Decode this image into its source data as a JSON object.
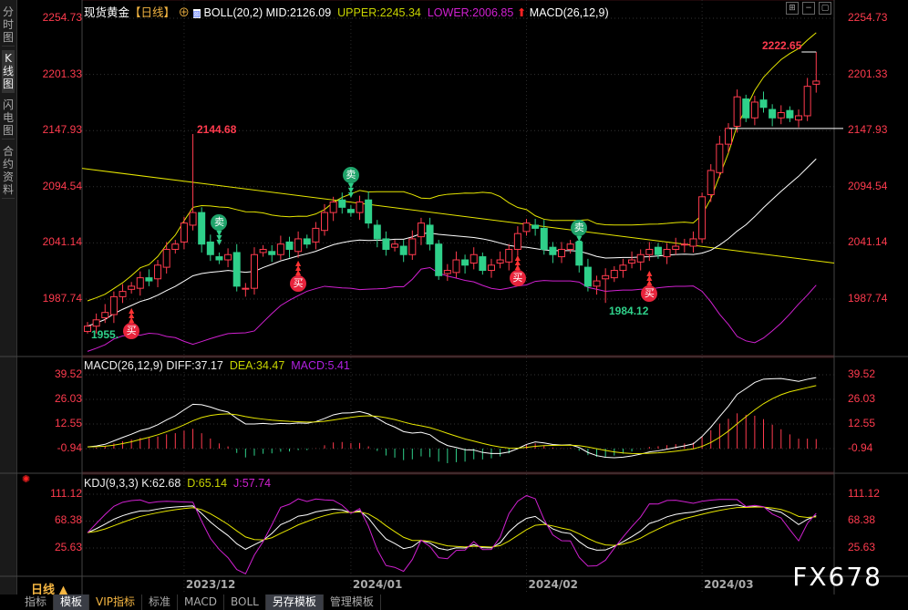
{
  "sidebar": {
    "items": [
      "分时图",
      "K线图",
      "闪电图",
      "合约资料"
    ],
    "active": 1
  },
  "header": {
    "instrument": "现货黄金",
    "period": "【日线】",
    "boll": "BOLL(20,2)",
    "mid": "MID:2126.09",
    "upper": "UPPER:2245.34",
    "lower": "LOWER:2006.85",
    "macd_title": "MACD(26,12,9)"
  },
  "macd_header": {
    "title": "MACD(26,12,9)",
    "diff": "DIFF:37.17",
    "dea": "DEA:34.47",
    "macd": "MACD:5.41"
  },
  "kdj_header": {
    "title": "KDJ(9,3,3)",
    "k": "K:62.68",
    "d": "D:65.14",
    "j": "J:57.74"
  },
  "price_axis": [
    "2254.73",
    "2201.33",
    "2147.93",
    "2094.54",
    "2041.14",
    "1987.74"
  ],
  "macd_axis": [
    "39.52",
    "26.03",
    "12.55",
    "-0.94"
  ],
  "kdj_axis": [
    "111.12",
    "68.38",
    "25.63"
  ],
  "annotations": {
    "high1": "2144.68",
    "high2": "2222.65",
    "low1": "1955.",
    "low2": "1984.12"
  },
  "date_labels": [
    {
      "label": "2023/12",
      "index": 11
    },
    {
      "label": "2024/01",
      "index": 30
    },
    {
      "label": "2024/02",
      "index": 50
    },
    {
      "label": "2024/03",
      "index": 70
    }
  ],
  "markers": [
    {
      "type": "buy",
      "text": "买",
      "index": 5
    },
    {
      "type": "sell",
      "text": "卖",
      "index": 15
    },
    {
      "type": "buy",
      "text": "买",
      "index": 24
    },
    {
      "type": "sell",
      "text": "卖",
      "index": 30
    },
    {
      "type": "buy",
      "text": "买",
      "index": 49
    },
    {
      "type": "sell",
      "text": "卖",
      "index": 56
    },
    {
      "type": "buy",
      "text": "买",
      "index": 64
    }
  ],
  "closes": [
    1962,
    1968,
    1975,
    1990,
    1995,
    2000,
    2008,
    2005,
    2020,
    2035,
    2040,
    2060,
    2070,
    2040,
    2030,
    2025,
    2030,
    2000,
    1998,
    2030,
    2035,
    2030,
    2040,
    2035,
    2045,
    2040,
    2055,
    2070,
    2080,
    2075,
    2070,
    2080,
    2060,
    2045,
    2035,
    2040,
    2030,
    2045,
    2060,
    2040,
    2010,
    2015,
    2025,
    2020,
    2030,
    2015,
    2020,
    2025,
    2035,
    2050,
    2060,
    2055,
    2035,
    2030,
    2035,
    2040,
    2020,
    2000,
    2005,
    2010,
    2015,
    2020,
    2025,
    2030,
    2035,
    2030,
    2035,
    2038,
    2040,
    2045,
    2085,
    2110,
    2135,
    2150,
    2180,
    2160,
    2175,
    2170,
    2160,
    2165,
    2160,
    2162,
    2190,
    2195
  ],
  "special_highs": {
    "12": 2144.68,
    "83": 2222.65
  },
  "special_lows": {
    "0": 1955,
    "59": 1984.12
  },
  "long_ma": [
    2112,
    2022
  ],
  "period_label": "日线",
  "tabs": [
    "指标",
    "模板",
    "VIP指标",
    "标准",
    "MACD",
    "BOLL",
    "另存模板",
    "管理模板"
  ],
  "watermark": "FX678",
  "colors": {
    "up": "#ff3b4e",
    "down": "#2fd08a",
    "mid": "#ffffff",
    "upper": "#e6e600",
    "lower": "#d020d0",
    "axis": "#ff3b4e"
  }
}
